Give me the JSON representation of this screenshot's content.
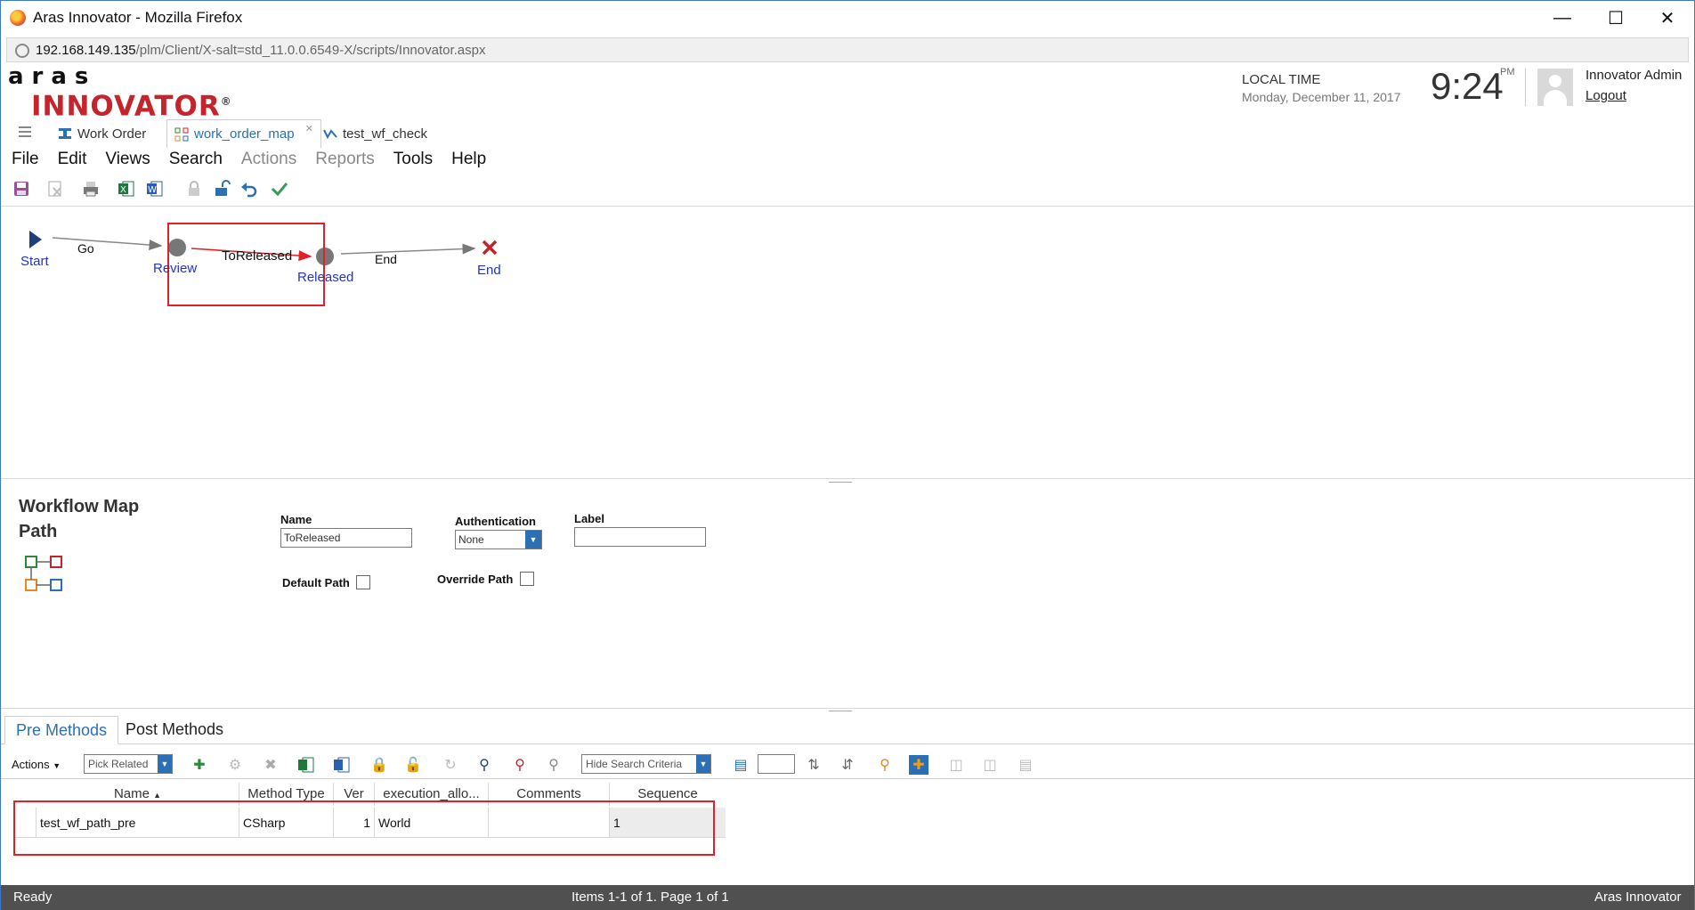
{
  "window": {
    "title": "Aras Innovator - Mozilla Firefox",
    "url_host": "192.168.149.135",
    "url_path": "/plm/Client/X-salt=std_11.0.0.6549-X/scripts/Innovator.aspx"
  },
  "header": {
    "logo_top": "aras",
    "logo_bottom": "INNOVATOR",
    "logo_reg": "®",
    "local_time_label": "LOCAL TIME",
    "date": "Monday, December 11, 2017",
    "time": "9:24",
    "ampm": "PM",
    "user": "Innovator Admin",
    "logout": "Logout"
  },
  "tabs": [
    {
      "label": "Work Order",
      "icon": "work-order-icon"
    },
    {
      "label": "work_order_map",
      "icon": "workflow-map-icon"
    },
    {
      "label": "test_wf_check",
      "icon": "workflow-icon"
    }
  ],
  "menu": [
    "File",
    "Edit",
    "Views",
    "Search",
    "Actions",
    "Reports",
    "Tools",
    "Help"
  ],
  "workflow": {
    "nodes": {
      "start": "Start",
      "review": "Review",
      "released": "Released",
      "end": "End"
    },
    "paths": {
      "go": "Go",
      "to_released": "ToReleased",
      "end": "End"
    }
  },
  "form": {
    "title_line1": "Workflow Map",
    "title_line2": "Path",
    "name_label": "Name",
    "name_value": "ToReleased",
    "auth_label": "Authentication",
    "auth_value": "None",
    "label_label": "Label",
    "label_value": "",
    "default_path_label": "Default Path",
    "override_path_label": "Override Path"
  },
  "relationships": {
    "tabs": [
      "Pre Methods",
      "Post Methods"
    ],
    "actions_label": "Actions",
    "pick_related": "Pick Related",
    "hide_search": "Hide Search Criteria",
    "columns": [
      "Name",
      "Method Type",
      "Ver",
      "execution_allo...",
      "Comments",
      "Sequence"
    ],
    "rows": [
      {
        "name": "test_wf_path_pre",
        "method_type": "CSharp",
        "ver": "1",
        "execution": "World",
        "comments": "",
        "sequence": "1"
      }
    ]
  },
  "status": {
    "left": "Ready",
    "center": "Items 1-1 of 1. Page 1 of 1",
    "right": "Aras Innovator"
  },
  "colors": {
    "accent": "#2b6fb5",
    "brand_red": "#c4252d",
    "highlight": "#e0202a",
    "status_bg": "#505050"
  }
}
